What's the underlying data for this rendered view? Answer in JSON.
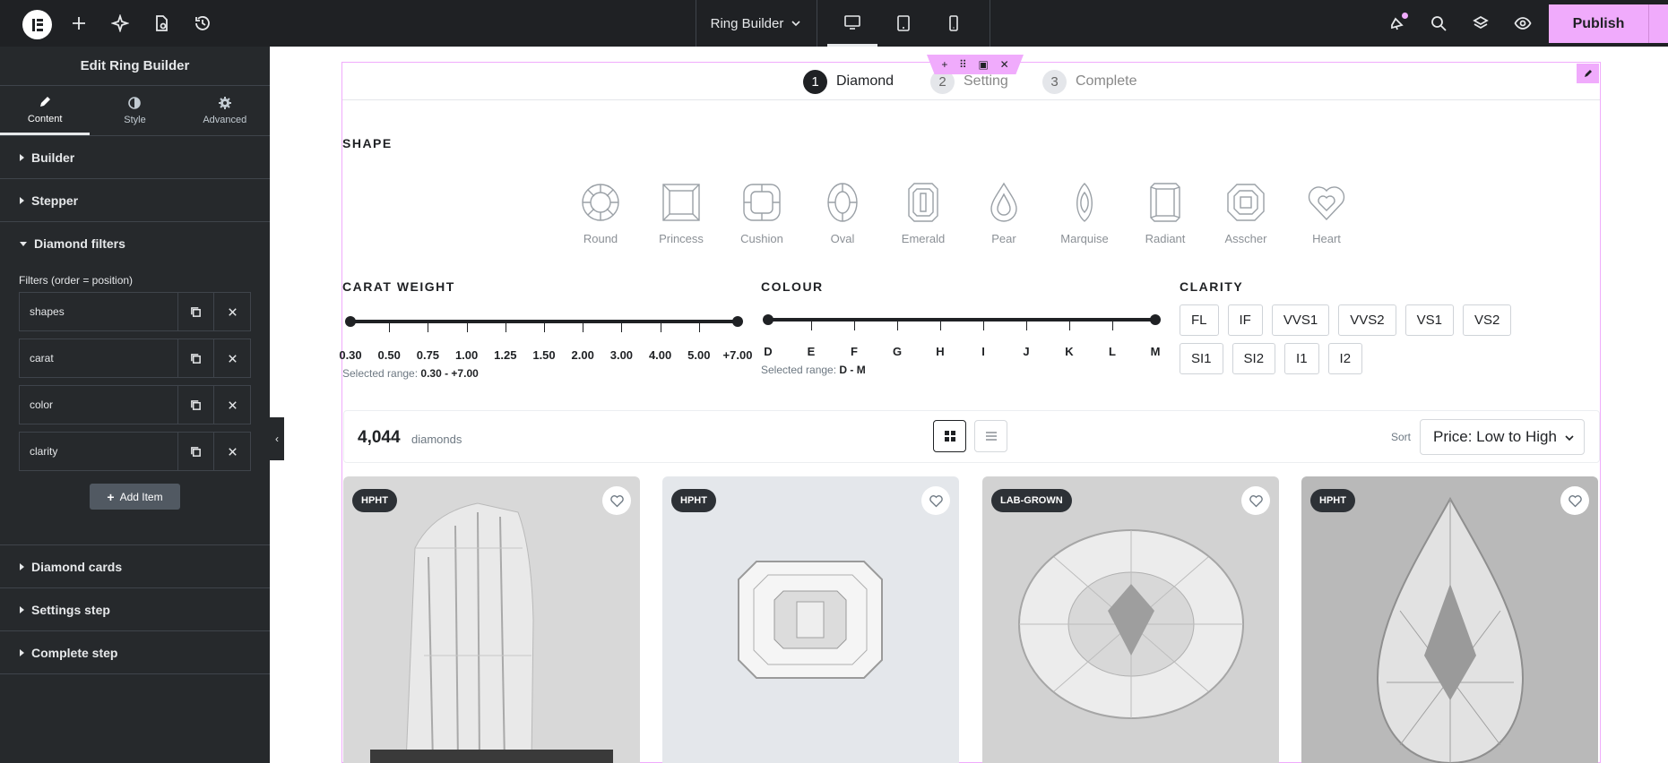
{
  "topbar": {
    "title": "Ring Builder",
    "publish_label": "Publish",
    "devices": [
      "desktop",
      "tablet",
      "mobile"
    ]
  },
  "panel": {
    "title": "Edit Ring Builder",
    "tabs": [
      {
        "label": "Content",
        "icon": "pencil-icon"
      },
      {
        "label": "Style",
        "icon": "contrast-icon"
      },
      {
        "label": "Advanced",
        "icon": "gear-icon"
      }
    ],
    "sections_top": [
      "Builder",
      "Stepper"
    ],
    "open_section": "Diamond filters",
    "filters_label": "Filters (order = position)",
    "filter_items": [
      "shapes",
      "carat",
      "color",
      "clarity"
    ],
    "add_item_label": "Add Item",
    "sections_bottom": [
      "Diamond cards",
      "Settings step",
      "Complete step"
    ]
  },
  "stepper": {
    "steps": [
      {
        "num": "1",
        "label": "Diamond"
      },
      {
        "num": "2",
        "label": "Setting"
      },
      {
        "num": "3",
        "label": "Complete"
      }
    ]
  },
  "shape_section": {
    "heading": "SHAPE",
    "shapes": [
      "Round",
      "Princess",
      "Cushion",
      "Oval",
      "Emerald",
      "Pear",
      "Marquise",
      "Radiant",
      "Asscher",
      "Heart"
    ]
  },
  "carat": {
    "heading": "CARAT WEIGHT",
    "ticks": [
      "0.30",
      "0.50",
      "0.75",
      "1.00",
      "1.25",
      "1.50",
      "2.00",
      "3.00",
      "4.00",
      "5.00",
      "+7.00"
    ],
    "range_prefix": "Selected range:",
    "range_value": "0.30 - +7.00"
  },
  "colour": {
    "heading": "COLOUR",
    "ticks": [
      "D",
      "E",
      "F",
      "G",
      "H",
      "I",
      "J",
      "K",
      "L",
      "M"
    ],
    "range_prefix": "Selected range:",
    "range_value": "D - M"
  },
  "clarity": {
    "heading": "CLARITY",
    "grades": [
      "FL",
      "IF",
      "VVS1",
      "VVS2",
      "VS1",
      "VS2",
      "SI1",
      "SI2",
      "I1",
      "I2"
    ]
  },
  "results": {
    "count": "4,044",
    "count_label": "diamonds",
    "sort_label": "Sort",
    "sort_value": "Price: Low to High"
  },
  "cards": [
    {
      "badge": "HPHT",
      "bg": "#d6d6d6"
    },
    {
      "badge": "HPHT",
      "bg": "#e3e6ea"
    },
    {
      "badge": "LAB-GROWN",
      "bg": "#cfcfcf"
    },
    {
      "badge": "HPHT",
      "bg": "#b8b8b8"
    }
  ],
  "colors": {
    "accent": "#f0abfc",
    "topbar": "#1f2124",
    "panel": "#26292c"
  }
}
